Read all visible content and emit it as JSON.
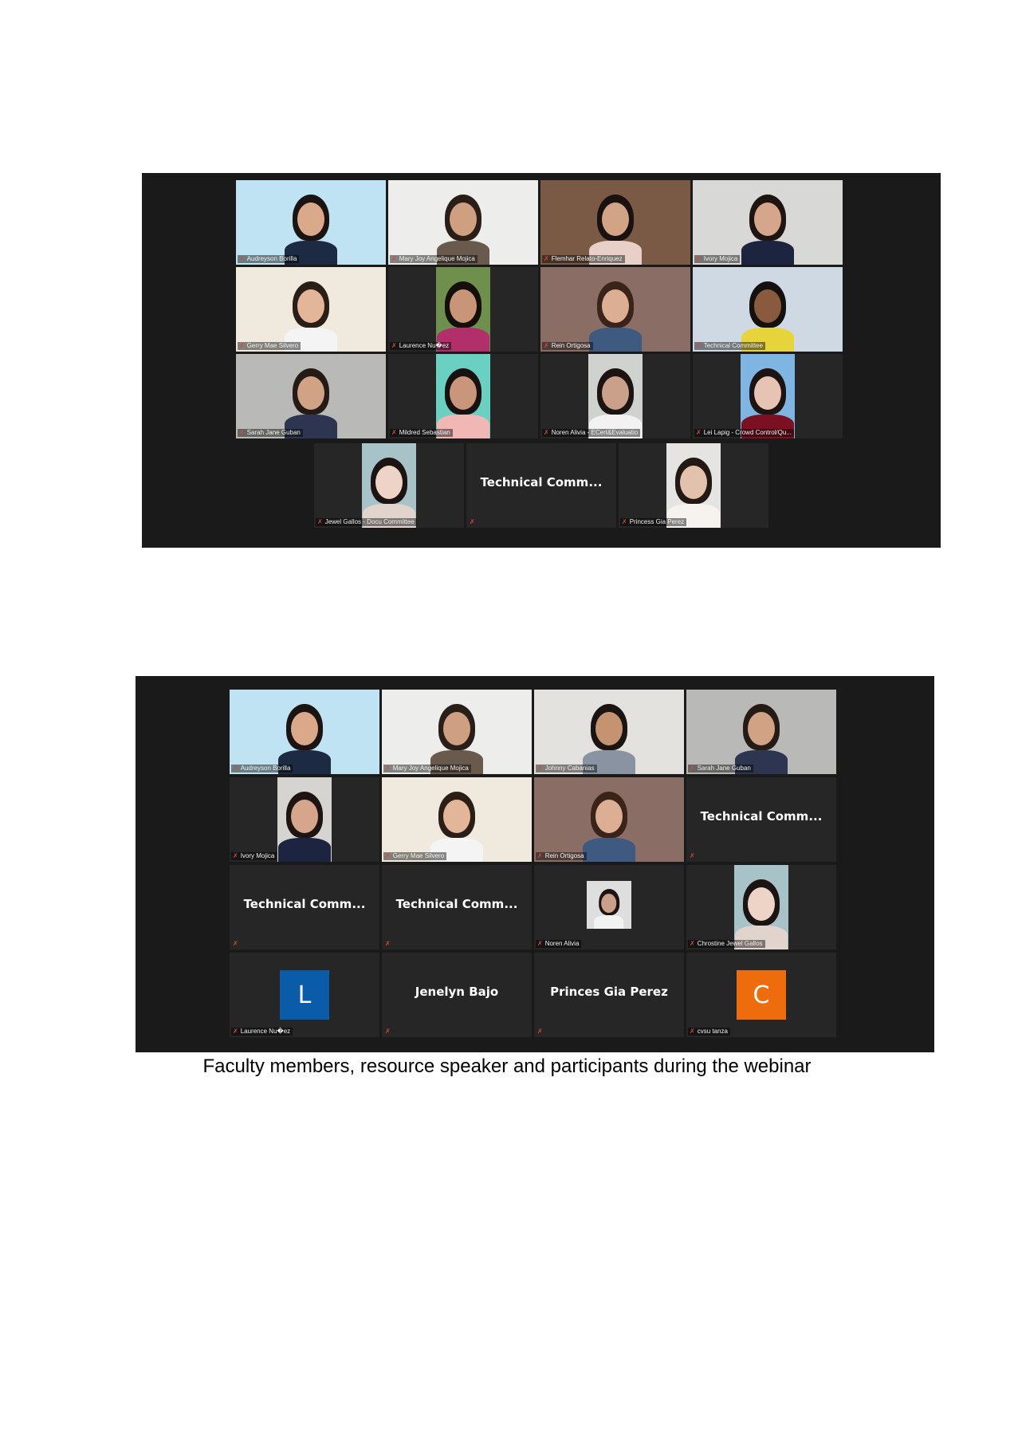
{
  "screenshot1": {
    "tiles": [
      {
        "name": "Audreyson Borilla",
        "kind": "video",
        "bg": "#bfe3f2",
        "skin": "#d9a98a",
        "hair": "#1b1412",
        "shirt": "#1c2a44"
      },
      {
        "name": "Mary Joy Angelique Mojica",
        "kind": "video",
        "bg": "#ededeb",
        "skin": "#cf9f82",
        "hair": "#2a1e18",
        "shirt": "#6a5a4e",
        "active": true
      },
      {
        "name": "Flemhar Relato-Enriquez",
        "kind": "video",
        "bg": "#7a5a45",
        "skin": "#d3a386",
        "hair": "#1a1210",
        "shirt": "#e8cfc8"
      },
      {
        "name": "Ivory Mojica",
        "kind": "video",
        "bg": "#d8d8d6",
        "skin": "#d6a68c",
        "hair": "#1e1412",
        "shirt": "#1d2440"
      },
      {
        "name": "Gerry Mae Silvero",
        "kind": "video",
        "bg": "#efe9de",
        "skin": "#e3b69a",
        "hair": "#2b1e16",
        "shirt": "#f4f4f4"
      },
      {
        "name": "Laurence Nu�ez",
        "kind": "video-narrow",
        "bg": "#6f8f4c",
        "skin": "#c99579",
        "hair": "#150f0c",
        "shirt": "#b1306c"
      },
      {
        "name": "Rein Ortigosa",
        "kind": "video",
        "bg": "#8a6e66",
        "skin": "#dcae93",
        "hair": "#3a2419",
        "shirt": "#3f5a80"
      },
      {
        "name": "Technical Committee",
        "kind": "video",
        "bg": "#cfd9e3",
        "skin": "#8a5a3e",
        "hair": "#141010",
        "shirt": "#e6d43a"
      },
      {
        "name": "Sarah Jane Guban",
        "kind": "video",
        "bg": "#b9b9b7",
        "skin": "#d1a283",
        "hair": "#241a16",
        "shirt": "#2e3550"
      },
      {
        "name": "Mildred Sebastian",
        "kind": "video-narrow",
        "bg": "#6ad0c2",
        "skin": "#c9967c",
        "hair": "#171110",
        "shirt": "#f0b7b4"
      },
      {
        "name": "Noren Alivia - ECert&Evaluatio",
        "kind": "video-narrow",
        "bg": "#cfd2cf",
        "skin": "#caa08a",
        "hair": "#1b1412",
        "shirt": "#f2f2f2"
      },
      {
        "name": "Lei Lapig - Crowd Control/Qu...",
        "kind": "video-narrow",
        "bg": "#7fb5e3",
        "skin": "#e6c3b3",
        "hair": "#1b1412",
        "shirt": "#7a1022"
      }
    ],
    "last_row": [
      {
        "name": "Jewel Gallos - Docu Committee",
        "kind": "video-narrow",
        "bg": "#a8c3c8",
        "skin": "#eed4c6",
        "hair": "#1b1412",
        "shirt": "#e0d4cc"
      },
      {
        "name": "",
        "kind": "text",
        "big": "Technical  Comm..."
      },
      {
        "name": "Princess Gia Perez",
        "kind": "video-narrow",
        "bg": "#e6e4e2",
        "skin": "#e2c1ad",
        "hair": "#221814",
        "shirt": "#f6f2ee"
      }
    ]
  },
  "screenshot2": {
    "tiles": [
      {
        "name": "Audreyson Borilla",
        "kind": "video",
        "bg": "#bfe3f2",
        "skin": "#d9a98a",
        "hair": "#1b1412",
        "shirt": "#1c2a44"
      },
      {
        "name": "Mary Joy Angelique Mojica",
        "kind": "video",
        "bg": "#ededeb",
        "skin": "#cf9f82",
        "hair": "#2a1e18",
        "shirt": "#6a5a4e",
        "active": true
      },
      {
        "name": "Johnny Cabanias",
        "kind": "video",
        "bg": "#e4e2de",
        "skin": "#c5936f",
        "hair": "#1a1412",
        "shirt": "#8a93a2"
      },
      {
        "name": "Sarah Jane Guban",
        "kind": "video",
        "bg": "#b9b9b7",
        "skin": "#d1a283",
        "hair": "#241a16",
        "shirt": "#2e3550"
      },
      {
        "name": "Ivory Mojica",
        "kind": "video-narrow",
        "bg": "#d6d4d0",
        "skin": "#d6a68c",
        "hair": "#1e1412",
        "shirt": "#1d2440"
      },
      {
        "name": "Gerry Mae Silvero",
        "kind": "video",
        "bg": "#efe9de",
        "skin": "#e3b69a",
        "hair": "#2b1e16",
        "shirt": "#f4f4f4"
      },
      {
        "name": "Rein Ortigosa",
        "kind": "video",
        "bg": "#8a6e66",
        "skin": "#dcae93",
        "hair": "#3a2419",
        "shirt": "#3f5a80"
      },
      {
        "name": "",
        "kind": "text",
        "big": "Technical  Comm..."
      },
      {
        "name": "",
        "kind": "text",
        "big": "Technical  Comm..."
      },
      {
        "name": "",
        "kind": "text",
        "big": "Technical  Comm..."
      },
      {
        "name": "Noren Alivia",
        "kind": "video-small",
        "bg": "#dedede",
        "skin": "#caa08a",
        "hair": "#1b1412",
        "shirt": "#f2f2f2"
      },
      {
        "name": "Chrostine Jewel Gallos",
        "kind": "video-narrow",
        "bg": "#a8c3c8",
        "skin": "#eed4c6",
        "hair": "#1b1412",
        "shirt": "#e0d4cc"
      },
      {
        "name": "Laurence Nu�ez",
        "kind": "avatar",
        "letter": "L",
        "color": "#0a5ba8"
      },
      {
        "name": "",
        "kind": "text",
        "big": "Jenelyn Bajo"
      },
      {
        "name": "",
        "kind": "text",
        "big": "Princes Gia Perez"
      },
      {
        "name": "cvsu tanza",
        "kind": "avatar",
        "letter": "C",
        "color": "#ef6c0c"
      }
    ]
  },
  "caption": "Faculty members, resource speaker and participants during the webinar"
}
